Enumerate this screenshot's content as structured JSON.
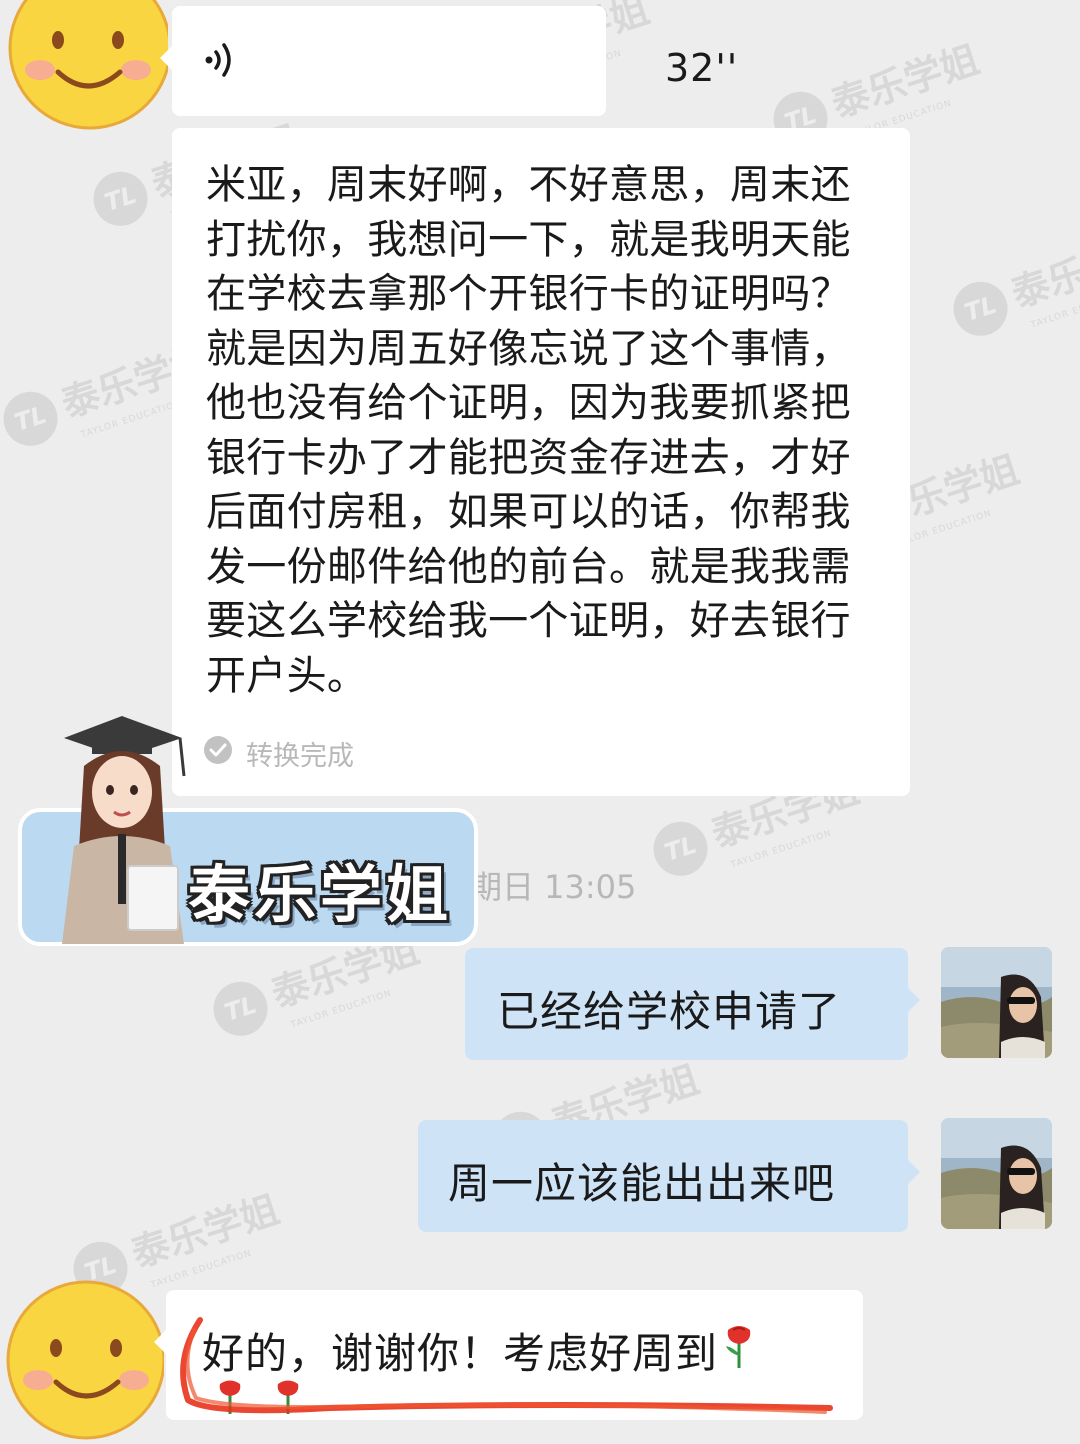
{
  "voice_message": {
    "duration": "32''"
  },
  "transcript": {
    "text": "米亚，周末好啊，不好意思，周末还打扰你，我想问一下，就是我明天能在学校去拿那个开银行卡的证明吗？就是因为周五好像忘说了这个事情，他也没有给个证明，因为我要抓紧把银行卡办了才能把资金存进去，才好后面付房租，如果可以的话，你帮我发一份邮件给他的前台。就是我我需要这么学校给我一个证明，好去银行开户头。",
    "status": "转换完成"
  },
  "timestamp": "期日 13:05",
  "badge": {
    "label": "泰乐学姐"
  },
  "messages": {
    "reply_1": "已经给学校申请了",
    "reply_2": "周一应该能出出来吧",
    "last": "好的，谢谢你！考虑好周到"
  },
  "watermark": {
    "name": "泰乐学姐",
    "sub": "TAYLOR EDUCATION",
    "logo": "TL"
  },
  "colors": {
    "chat_bg": "#ededed",
    "incoming_bubble": "#ffffff",
    "outgoing_bubble": "#cfe3f7",
    "badge": "#bcd9f2",
    "scribble": "#e8331c"
  },
  "icons": [
    "smiley-avatar",
    "voice-wave-icon",
    "check-circle-icon",
    "rose-icon",
    "photo-avatar"
  ]
}
